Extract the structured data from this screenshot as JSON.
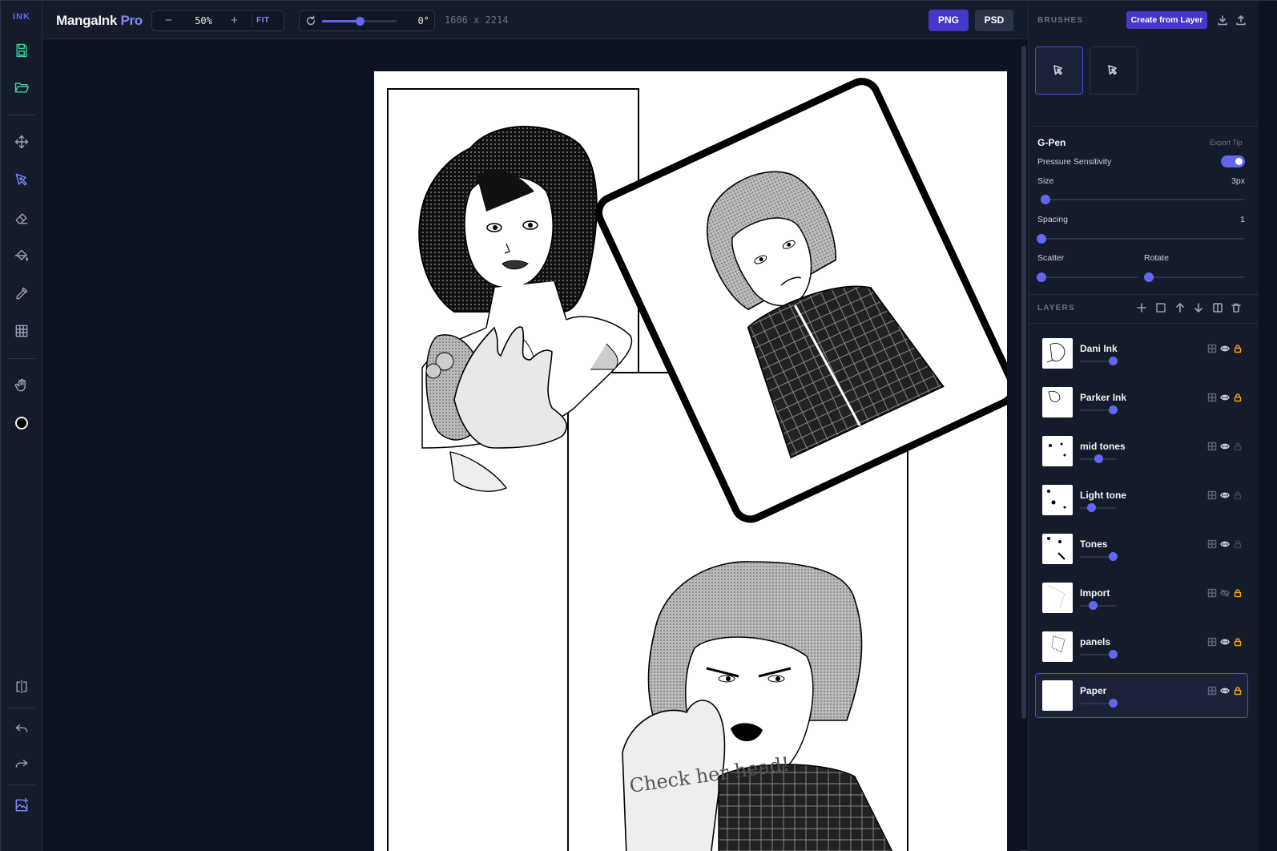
{
  "app": {
    "brand_tag": "INK",
    "title_main": "MangaInk",
    "title_pro": "Pro"
  },
  "toolbar": {
    "tools": [
      {
        "id": "save",
        "icon": "save-icon"
      },
      {
        "id": "open",
        "icon": "folder-open-icon"
      },
      {
        "id": "move",
        "icon": "move-icon"
      },
      {
        "id": "pen",
        "icon": "pen-tool-icon",
        "active": true
      },
      {
        "id": "eraser",
        "icon": "eraser-icon"
      },
      {
        "id": "fill",
        "icon": "paint-bucket-icon"
      },
      {
        "id": "eyedropper",
        "icon": "eyedropper-icon"
      },
      {
        "id": "grid",
        "icon": "grid-icon"
      },
      {
        "id": "hand",
        "icon": "hand-icon"
      },
      {
        "id": "color",
        "icon": "color-swatch-icon",
        "color": "#000000"
      },
      {
        "id": "mirror",
        "icon": "mirror-icon"
      },
      {
        "id": "undo",
        "icon": "undo-icon"
      },
      {
        "id": "redo",
        "icon": "redo-icon"
      },
      {
        "id": "image-add",
        "icon": "image-plus-icon"
      }
    ]
  },
  "topbar": {
    "zoom_minus": "−",
    "zoom_value": "50%",
    "zoom_plus": "+",
    "fit_label": "FIT",
    "rotation_value": "0°",
    "rotation_fraction": 0.5,
    "canvas_dims": "1606 x 2214",
    "export_png": "PNG",
    "export_psd": "PSD"
  },
  "brushes": {
    "title": "BRUSHES",
    "create_button": "Create from Layer",
    "selected_brush": "G-Pen",
    "export_tip": "Export Tip",
    "pressure_label": "Pressure Sensitivity",
    "pressure_on": true,
    "size_label": "Size",
    "size_value": "3px",
    "size_fraction": 0.02,
    "spacing_label": "Spacing",
    "spacing_value": "1",
    "spacing_fraction": 0.0,
    "scatter_label": "Scatter",
    "scatter_fraction": 0.0,
    "rotate_label": "Rotate",
    "rotate_fraction": 0.0
  },
  "layers": {
    "title": "LAYERS",
    "items": [
      {
        "name": "Dani Ink",
        "opacity": 0.9,
        "visible": true,
        "locked": true
      },
      {
        "name": "Parker Ink",
        "opacity": 0.9,
        "visible": true,
        "locked": true
      },
      {
        "name": "mid tones",
        "opacity": 0.5,
        "visible": true,
        "locked": false
      },
      {
        "name": "Light tone",
        "opacity": 0.3,
        "visible": true,
        "locked": false
      },
      {
        "name": "Tones",
        "opacity": 0.9,
        "visible": true,
        "locked": false
      },
      {
        "name": "Import",
        "opacity": 0.35,
        "visible": false,
        "locked": true
      },
      {
        "name": "panels",
        "opacity": 0.9,
        "visible": true,
        "locked": true
      },
      {
        "name": "Paper",
        "opacity": 0.9,
        "visible": true,
        "locked": true,
        "active": true
      }
    ]
  },
  "colors": {
    "accent": "#6366f1",
    "accent_dark": "#4338ca",
    "lock": "#f59e0b",
    "save_green": "#34d399"
  },
  "canvas": {
    "caption_text": "Check her head!"
  }
}
